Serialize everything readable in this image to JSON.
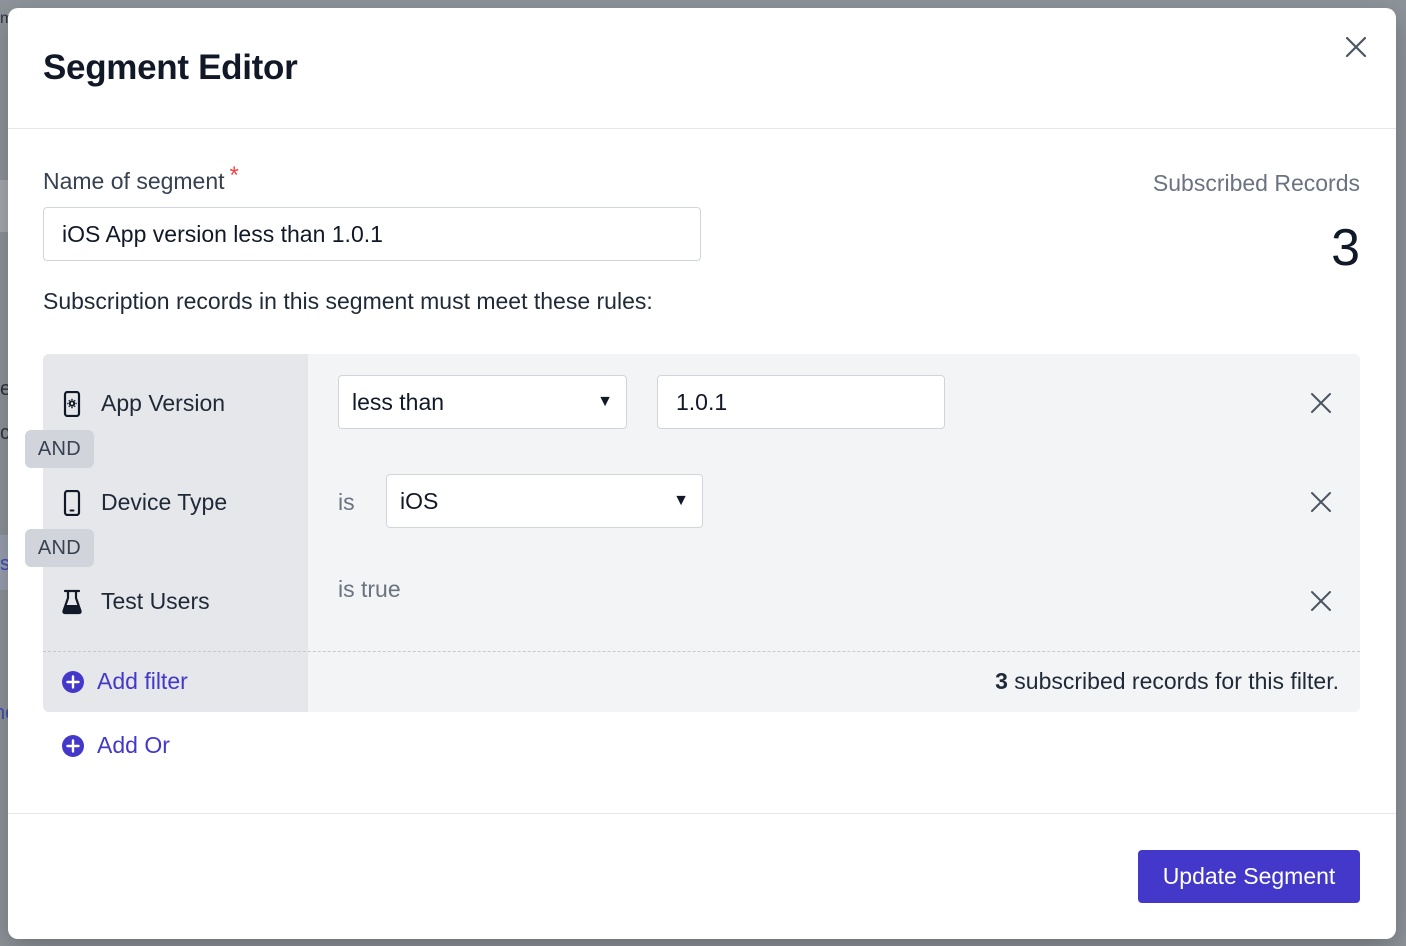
{
  "backdrop": {
    "chars": [
      "m",
      "e",
      "c",
      "s",
      "ne"
    ]
  },
  "modal": {
    "title": "Segment Editor",
    "close_icon": "close-icon"
  },
  "form": {
    "name_label": "Name of segment",
    "required_marker": "*",
    "name_value": "iOS App version less than 1.0.1",
    "rules_caption": "Subscription records in this segment must meet these rules:"
  },
  "stats": {
    "label": "Subscribed Records",
    "count": "3"
  },
  "filters": [
    {
      "name": "App Version",
      "icon": "app-settings-icon",
      "operator_select": "less than",
      "value": "1.0.1"
    },
    {
      "name": "Device Type",
      "icon": "mobile-device-icon",
      "operator_text": "is",
      "value_select": "iOS"
    },
    {
      "name": "Test Users",
      "icon": "flask-icon",
      "operator_text": "is true"
    }
  ],
  "connectors": [
    "AND",
    "AND"
  ],
  "actions": {
    "add_filter": "Add filter",
    "add_or": "Add Or",
    "update": "Update Segment"
  },
  "filter_summary": {
    "count": "3",
    "text": " subscribed records for this filter."
  },
  "colors": {
    "accent": "#4338ca",
    "required": "#ef4444",
    "rules_bg": "#f3f4f6",
    "rules_left_bg": "#e5e7eb"
  }
}
